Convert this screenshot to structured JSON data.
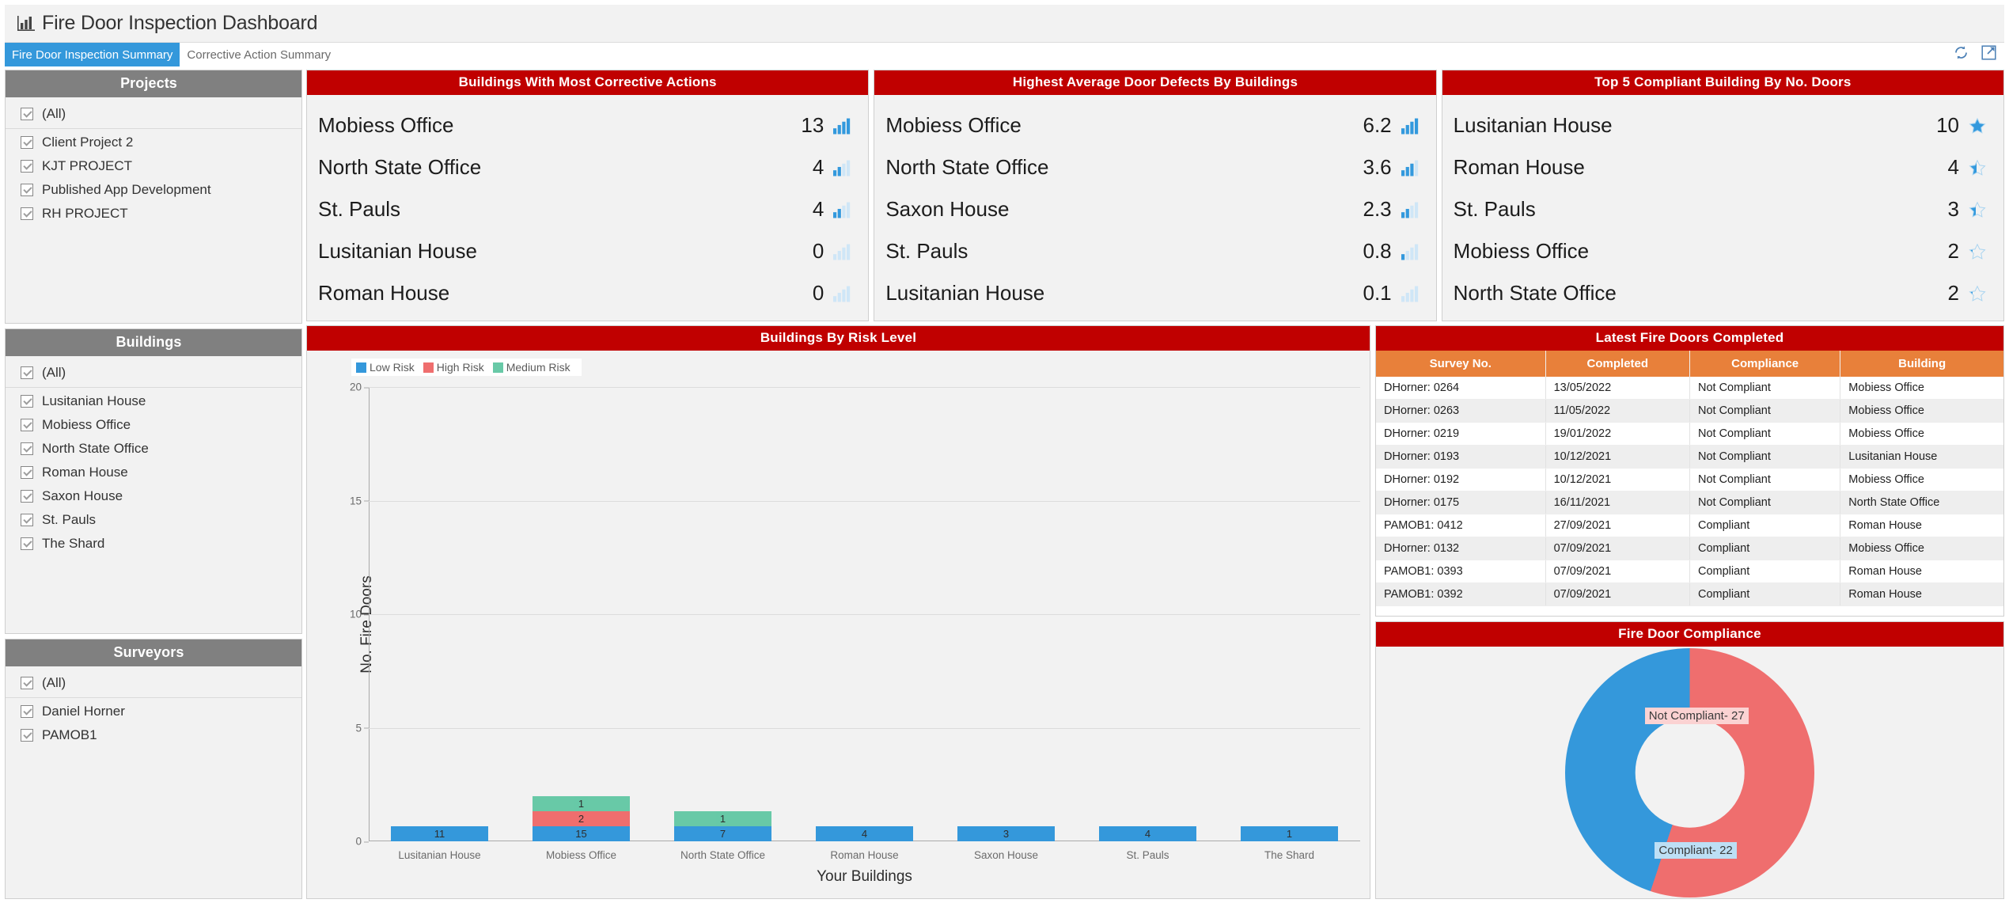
{
  "header": {
    "title": "Fire Door Inspection Dashboard",
    "icon": "bar-chart-icon"
  },
  "tabs": [
    {
      "label": "Fire Door Inspection Summary",
      "active": true
    },
    {
      "label": "Corrective Action Summary",
      "active": false
    }
  ],
  "toolbar": {
    "refresh_icon": "refresh-icon",
    "fullscreen_icon": "fullscreen-icon"
  },
  "filters": {
    "projects": {
      "title": "Projects",
      "items": [
        "(All)",
        "Client Project 2",
        "KJT PROJECT",
        "Published App Development",
        "RH PROJECT"
      ]
    },
    "buildings": {
      "title": "Buildings",
      "items": [
        "(All)",
        "Lusitanian House",
        "Mobiess Office",
        "North State Office",
        "Roman House",
        "Saxon House",
        "St. Pauls",
        "The Shard"
      ]
    },
    "surveyors": {
      "title": "Surveyors",
      "items": [
        "(All)",
        "Daniel Horner",
        "PAMOB1"
      ]
    }
  },
  "kpi_cards": [
    {
      "title": "Buildings With Most Corrective Actions",
      "icon": "bar-chart-icon",
      "rows": [
        {
          "label": "Mobiess Office",
          "value": "13",
          "fill": 1.0
        },
        {
          "label": "North State Office",
          "value": "4",
          "fill": 0.45
        },
        {
          "label": "St. Pauls",
          "value": "4",
          "fill": 0.45
        },
        {
          "label": "Lusitanian House",
          "value": "0",
          "fill": 0.0
        },
        {
          "label": "Roman House",
          "value": "0",
          "fill": 0.0
        }
      ]
    },
    {
      "title": "Highest Average Door Defects By Buildings",
      "icon": "bar-chart-icon",
      "rows": [
        {
          "label": "Mobiess Office",
          "value": "6.2",
          "fill": 1.0
        },
        {
          "label": "North State Office",
          "value": "3.6",
          "fill": 0.8
        },
        {
          "label": "Saxon House",
          "value": "2.3",
          "fill": 0.5
        },
        {
          "label": "St. Pauls",
          "value": "0.8",
          "fill": 0.2
        },
        {
          "label": "Lusitanian House",
          "value": "0.1",
          "fill": 0.05
        }
      ]
    },
    {
      "title": "Top 5 Compliant Building By No. Doors",
      "icon": "star-icon",
      "rows": [
        {
          "label": "Lusitanian House",
          "value": "10",
          "fill": 1.0
        },
        {
          "label": "Roman House",
          "value": "4",
          "fill": 0.45
        },
        {
          "label": "St. Pauls",
          "value": "3",
          "fill": 0.4
        },
        {
          "label": "Mobiess Office",
          "value": "2",
          "fill": 0.18
        },
        {
          "label": "North State Office",
          "value": "2",
          "fill": 0.18
        }
      ]
    }
  ],
  "bar_panel": {
    "title": "Buildings By Risk Level"
  },
  "table_panel": {
    "title": "Latest Fire Doors Completed",
    "columns": [
      "Survey No.",
      "Completed",
      "Compliance",
      "Building"
    ],
    "rows": [
      [
        "DHorner: 0264",
        "13/05/2022",
        "Not Compliant",
        "Mobiess Office"
      ],
      [
        "DHorner: 0263",
        "11/05/2022",
        "Not Compliant",
        "Mobiess Office"
      ],
      [
        "DHorner: 0219",
        "19/01/2022",
        "Not Compliant",
        "Mobiess Office"
      ],
      [
        "DHorner: 0193",
        "10/12/2021",
        "Not Compliant",
        "Lusitanian House"
      ],
      [
        "DHorner: 0192",
        "10/12/2021",
        "Not Compliant",
        "Mobiess Office"
      ],
      [
        "DHorner: 0175",
        "16/11/2021",
        "Not Compliant",
        "North State Office"
      ],
      [
        "PAMOB1: 0412",
        "27/09/2021",
        "Compliant",
        "Roman House"
      ],
      [
        "DHorner: 0132",
        "07/09/2021",
        "Compliant",
        "Mobiess Office"
      ],
      [
        "PAMOB1: 0393",
        "07/09/2021",
        "Compliant",
        "Roman House"
      ],
      [
        "PAMOB1: 0392",
        "07/09/2021",
        "Compliant",
        "Roman House"
      ]
    ]
  },
  "donut_panel": {
    "title": "Fire Door Compliance"
  },
  "colors": {
    "brand_red": "#c00000",
    "header_gray": "#808080",
    "table_header_orange": "#e8803a",
    "low_risk_blue": "#3498db",
    "high_risk_red": "#ef6e6e",
    "medium_risk_green": "#68c9a7",
    "tab_active_blue": "#3498db"
  },
  "chart_data": [
    {
      "type": "bar",
      "title": "Buildings By Risk Level",
      "xlabel": "Your Buildings",
      "ylabel": "No. Fire Doors",
      "ylim": [
        0,
        20
      ],
      "yticks": [
        0,
        5,
        10,
        15,
        20
      ],
      "stacked": true,
      "legend": [
        "Low Risk",
        "High Risk",
        "Medium Risk"
      ],
      "legend_position": "top-left",
      "grid": true,
      "categories": [
        "Lusitanian House",
        "Mobiess Office",
        "North State Office",
        "Roman House",
        "Saxon House",
        "St. Pauls",
        "The Shard"
      ],
      "series": [
        {
          "name": "Low Risk",
          "color": "#3498db",
          "values": [
            11,
            15,
            7,
            4,
            3,
            4,
            1
          ]
        },
        {
          "name": "High Risk",
          "color": "#ef6e6e",
          "values": [
            0,
            2,
            0,
            0,
            0,
            0,
            0
          ]
        },
        {
          "name": "Medium Risk",
          "color": "#68c9a7",
          "values": [
            0,
            1,
            1,
            0,
            0,
            0,
            0
          ]
        }
      ]
    },
    {
      "type": "pie",
      "variant": "donut",
      "title": "Fire Door Compliance",
      "labels": [
        "Not Compliant",
        "Compliant"
      ],
      "values": [
        27,
        22
      ],
      "colors": [
        "#ef6e6e",
        "#3498db"
      ],
      "data_labels": [
        "Not Compliant- 27",
        "Compliant- 22"
      ]
    }
  ]
}
